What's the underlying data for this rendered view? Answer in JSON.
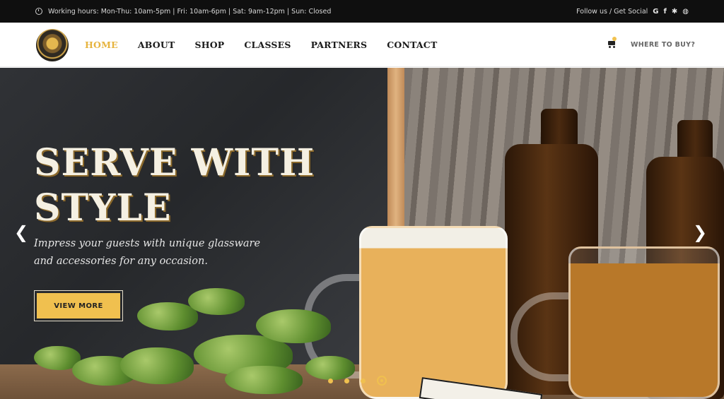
{
  "topbar": {
    "working_hours": "Working hours: Mon-Thu: 10am-5pm | Fri: 10am-6pm | Sat: 9am-12pm | Sun: Closed",
    "follow_label": "Follow us / Get Social",
    "social_icons": [
      "google-icon",
      "facebook-icon",
      "yelp-icon",
      "globe-icon"
    ]
  },
  "nav": {
    "items": [
      "HOME",
      "ABOUT",
      "SHOP",
      "CLASSES",
      "PARTNERS",
      "CONTACT"
    ],
    "active_item": "HOME",
    "where_to_buy": "WHERE TO BUY?",
    "cart_icon": "cart-icon"
  },
  "hero": {
    "title_line1": "SERVE WITH",
    "title_line2": "STYLE",
    "subtitle": "Impress your guests with unique glassware and accessories for any occasion.",
    "button_label": "VIEW MORE",
    "prev_icon": "chevron-left-icon",
    "next_icon": "chevron-right-icon",
    "active_slide_index": 3,
    "slide_count": 4
  },
  "colors": {
    "accent": "#f0c04f",
    "topbar_bg": "#0f0f0f",
    "nav_text": "#1b1b1b"
  }
}
